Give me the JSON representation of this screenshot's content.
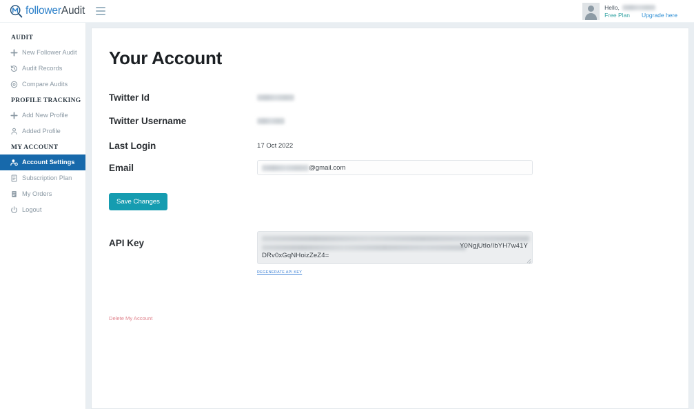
{
  "brand": {
    "name_part1": "follower",
    "name_part2": "Audit",
    "logo_icon": "magnifier-logo-icon",
    "menu_icon": "hamburger-menu-icon"
  },
  "header": {
    "greeting": "Hello,",
    "username_redacted": "",
    "plan": "Free Plan",
    "upgrade_label": "Upgrade here",
    "avatar_icon": "user-avatar-icon"
  },
  "sidebar": {
    "sections": [
      {
        "heading": "AUDIT",
        "items": [
          {
            "label": "New Follower Audit",
            "icon": "plus-icon",
            "active": false
          },
          {
            "label": "Audit Records",
            "icon": "history-icon",
            "active": false
          },
          {
            "label": "Compare Audits",
            "icon": "target-icon",
            "active": false
          }
        ]
      },
      {
        "heading": "PROFILE TRACKING",
        "items": [
          {
            "label": "Add New Profile",
            "icon": "plus-icon",
            "active": false
          },
          {
            "label": "Added Profile",
            "icon": "person-icon",
            "active": false
          }
        ]
      },
      {
        "heading": "MY ACCOUNT",
        "items": [
          {
            "label": "Account Settings",
            "icon": "user-gear-icon",
            "active": true
          },
          {
            "label": "Subscription Plan",
            "icon": "document-icon",
            "active": false
          },
          {
            "label": "My Orders",
            "icon": "orders-icon",
            "active": false
          },
          {
            "label": "Logout",
            "icon": "power-icon",
            "active": false
          }
        ]
      }
    ]
  },
  "main": {
    "title": "Your Account",
    "fields": {
      "twitter_id_label": "Twitter Id",
      "twitter_id_value": "",
      "twitter_username_label": "Twitter Username",
      "twitter_username_value": "",
      "last_login_label": "Last Login",
      "last_login_value": "17 Oct 2022",
      "email_label": "Email",
      "email_value_visible": "@gmail.com",
      "email_value_redacted": ""
    },
    "save_label": "Save Changes",
    "api_key": {
      "label": "API Key",
      "value_tail_line1": "Y0NgjUtIo/IbYH7w41Y",
      "value_tail_line2": "DRv0xGqNHoizZeZ4=",
      "regenerate_label": "REGENERATE API KEY"
    },
    "delete_label": "Delete My Account"
  },
  "colors": {
    "brand_blue": "#2a7fc9",
    "active_nav_blue": "#1769ab",
    "save_teal": "#159cb0",
    "plan_teal": "#3aa6a6",
    "link_blue": "#2f8fd4",
    "delete_red": "#e0848e",
    "page_bg": "#e9eef2"
  }
}
